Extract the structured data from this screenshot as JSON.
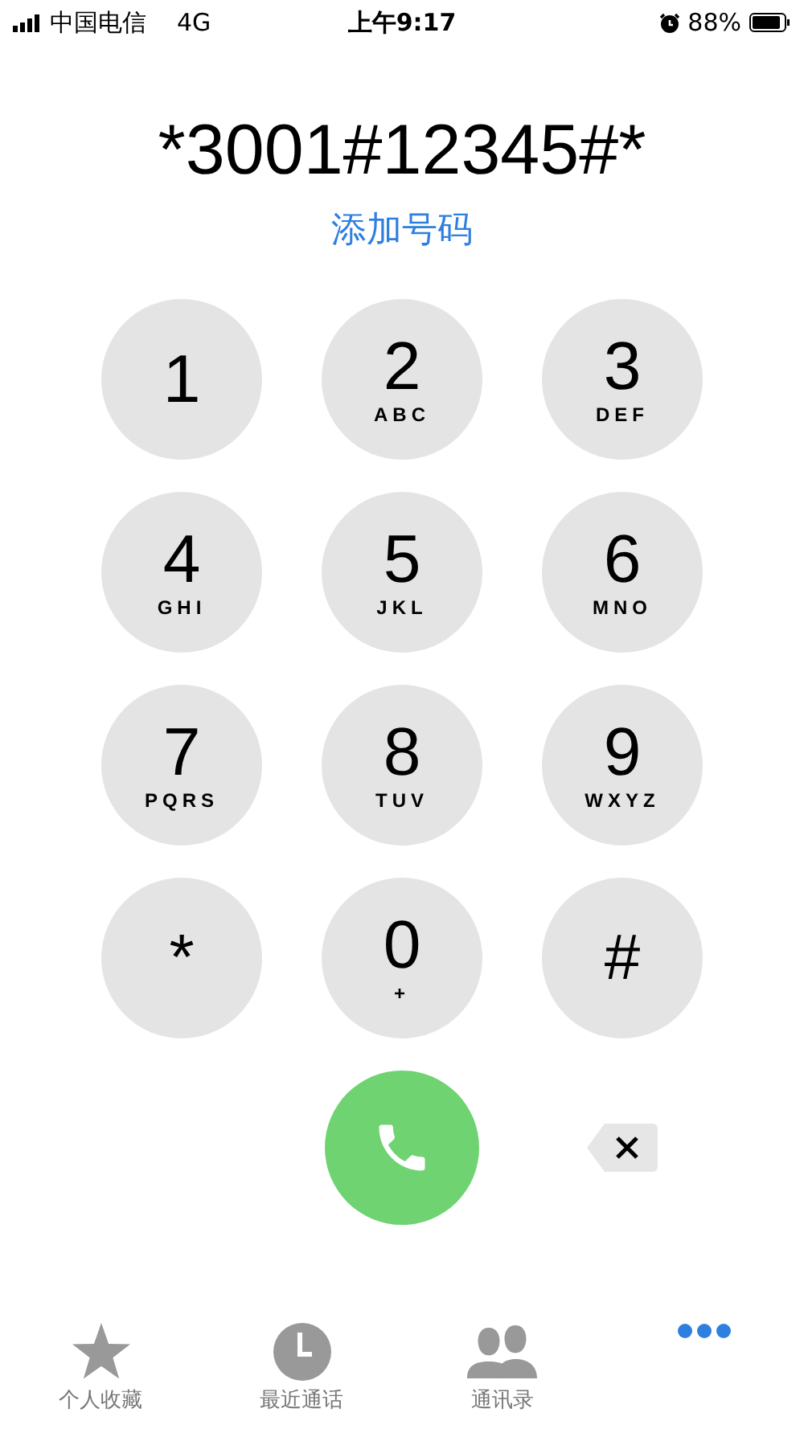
{
  "status_bar": {
    "carrier": "中国电信",
    "network": "4G",
    "time": "上午9:17",
    "battery_text": "88%"
  },
  "dialer": {
    "number": "*3001#12345#*",
    "add_number": "添加号码"
  },
  "keys": [
    {
      "digit": "1"
    },
    {
      "digit": "2",
      "letters": "ABC"
    },
    {
      "digit": "3",
      "letters": "DEF"
    },
    {
      "digit": "4",
      "letters": "GHI"
    },
    {
      "digit": "5",
      "letters": "JKL"
    },
    {
      "digit": "6",
      "letters": "MNO"
    },
    {
      "digit": "7",
      "letters": "PQRS"
    },
    {
      "digit": "8",
      "letters": "TUV"
    },
    {
      "digit": "9",
      "letters": "WXYZ"
    },
    {
      "digit": "*"
    },
    {
      "digit": "0",
      "letters": "+"
    },
    {
      "digit": "#"
    }
  ],
  "tabs": [
    {
      "kind": "star",
      "label": "个人收藏",
      "selected": false
    },
    {
      "kind": "clock",
      "label": "最近通话",
      "selected": false
    },
    {
      "kind": "contacts",
      "label": "通讯录",
      "selected": false
    },
    {
      "kind": "keypad",
      "selected": true
    }
  ]
}
